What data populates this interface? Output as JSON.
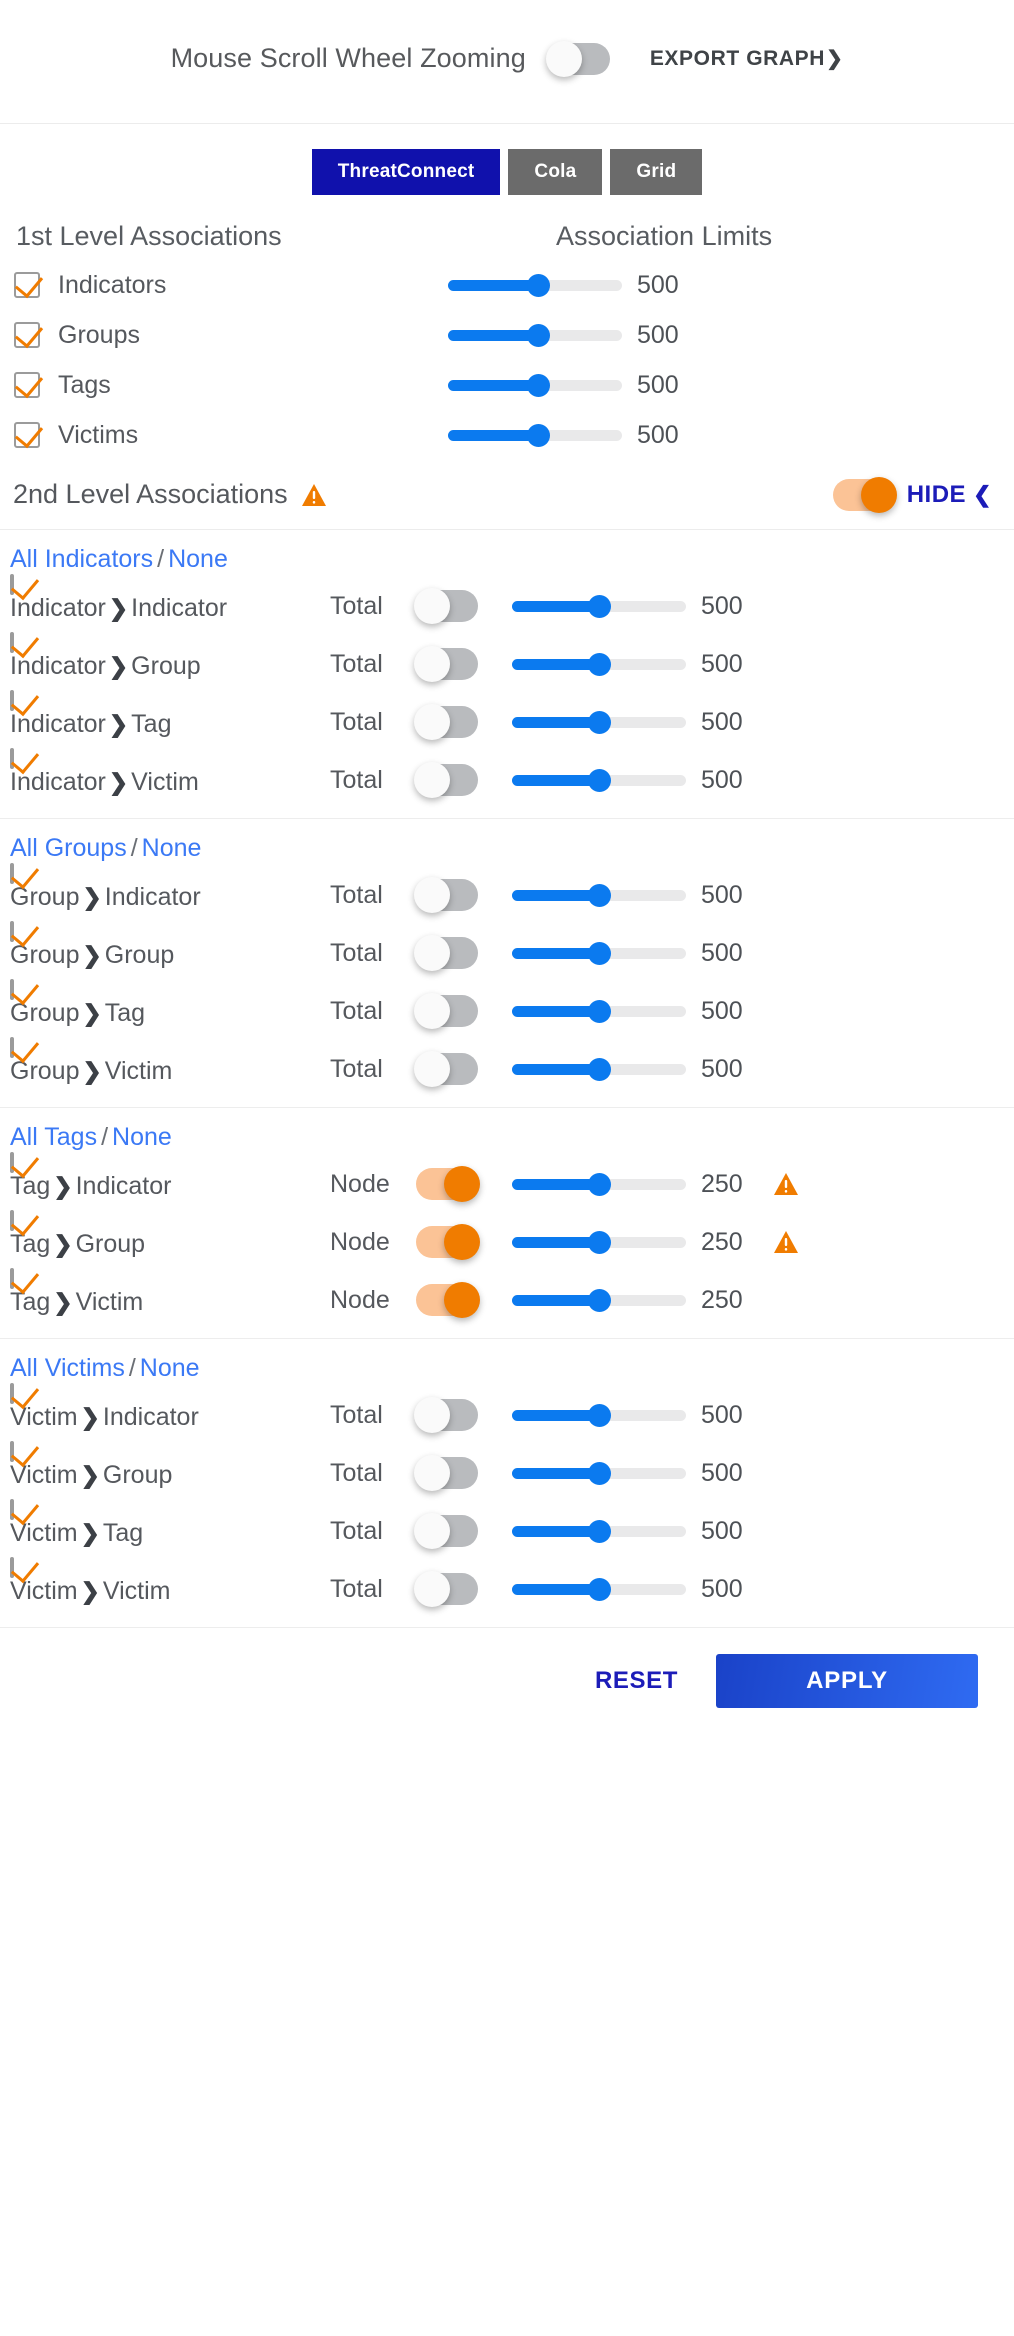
{
  "header": {
    "zoom_label": "Mouse Scroll Wheel Zooming",
    "zoom_toggle_state": "off",
    "export_label": "EXPORT GRAPH",
    "export_chevron": "chevron-down-icon"
  },
  "layout_modes": {
    "items": [
      {
        "label": "ThreatConnect",
        "active": true
      },
      {
        "label": "Cola",
        "active": false
      },
      {
        "label": "Grid",
        "active": false
      }
    ],
    "active_color": "#1011ac",
    "inactive_color": "#6b6b6b"
  },
  "first_level": {
    "title": "1st Level Associations",
    "limits_title": "Association Limits",
    "rows": [
      {
        "label": "Indicators",
        "checked": true,
        "value": "500",
        "percent": 52
      },
      {
        "label": "Groups",
        "checked": true,
        "value": "500",
        "percent": 52
      },
      {
        "label": "Tags",
        "checked": true,
        "value": "500",
        "percent": 52
      },
      {
        "label": "Victims",
        "checked": true,
        "value": "500",
        "percent": 52
      }
    ]
  },
  "second_level": {
    "title": "2nd Level Associations",
    "warning_icon": "warning-triangle-icon",
    "toggle_state": "on",
    "hide_label": "HIDE",
    "hide_chevron": "chevron-up-icon"
  },
  "sections": [
    {
      "all_label": "All Indicators",
      "separator": "/",
      "none_label": "None",
      "rows": [
        {
          "source": "Indicator",
          "target": "Indicator",
          "checked": true,
          "mode": "Total",
          "toggle_state": "off",
          "value": "500",
          "percent": 50,
          "warning": false
        },
        {
          "source": "Indicator",
          "target": "Group",
          "checked": true,
          "mode": "Total",
          "toggle_state": "off",
          "value": "500",
          "percent": 50,
          "warning": false
        },
        {
          "source": "Indicator",
          "target": "Tag",
          "checked": true,
          "mode": "Total",
          "toggle_state": "off",
          "value": "500",
          "percent": 50,
          "warning": false
        },
        {
          "source": "Indicator",
          "target": "Victim",
          "checked": true,
          "mode": "Total",
          "toggle_state": "off",
          "value": "500",
          "percent": 50,
          "warning": false
        }
      ]
    },
    {
      "all_label": "All Groups",
      "separator": "/",
      "none_label": "None",
      "rows": [
        {
          "source": "Group",
          "target": "Indicator",
          "checked": true,
          "mode": "Total",
          "toggle_state": "off",
          "value": "500",
          "percent": 50,
          "warning": false
        },
        {
          "source": "Group",
          "target": "Group",
          "checked": true,
          "mode": "Total",
          "toggle_state": "off",
          "value": "500",
          "percent": 50,
          "warning": false
        },
        {
          "source": "Group",
          "target": "Tag",
          "checked": true,
          "mode": "Total",
          "toggle_state": "off",
          "value": "500",
          "percent": 50,
          "warning": false
        },
        {
          "source": "Group",
          "target": "Victim",
          "checked": true,
          "mode": "Total",
          "toggle_state": "off",
          "value": "500",
          "percent": 50,
          "warning": false
        }
      ]
    },
    {
      "all_label": "All Tags",
      "separator": "/",
      "none_label": "None",
      "rows": [
        {
          "source": "Tag",
          "target": "Indicator",
          "checked": true,
          "mode": "Node",
          "toggle_state": "on",
          "value": "250",
          "percent": 50,
          "warning": true
        },
        {
          "source": "Tag",
          "target": "Group",
          "checked": true,
          "mode": "Node",
          "toggle_state": "on",
          "value": "250",
          "percent": 50,
          "warning": true
        },
        {
          "source": "Tag",
          "target": "Victim",
          "checked": true,
          "mode": "Node",
          "toggle_state": "on",
          "value": "250",
          "percent": 50,
          "warning": false
        }
      ]
    },
    {
      "all_label": "All Victims",
      "separator": "/",
      "none_label": "None",
      "rows": [
        {
          "source": "Victim",
          "target": "Indicator",
          "checked": true,
          "mode": "Total",
          "toggle_state": "off",
          "value": "500",
          "percent": 50,
          "warning": false
        },
        {
          "source": "Victim",
          "target": "Group",
          "checked": true,
          "mode": "Total",
          "toggle_state": "off",
          "value": "500",
          "percent": 50,
          "warning": false
        },
        {
          "source": "Victim",
          "target": "Tag",
          "checked": true,
          "mode": "Total",
          "toggle_state": "off",
          "value": "500",
          "percent": 50,
          "warning": false
        },
        {
          "source": "Victim",
          "target": "Victim",
          "checked": true,
          "mode": "Total",
          "toggle_state": "off",
          "value": "500",
          "percent": 50,
          "warning": false
        }
      ]
    }
  ],
  "footer": {
    "reset_label": "RESET",
    "apply_label": "APPLY"
  },
  "colors": {
    "accent_blue": "#0b7aef",
    "link_blue": "#3b79f5",
    "dark_blue": "#1c1cb8",
    "orange": "#f07c00",
    "orange_light": "#fbc396",
    "text": "#55585d"
  }
}
